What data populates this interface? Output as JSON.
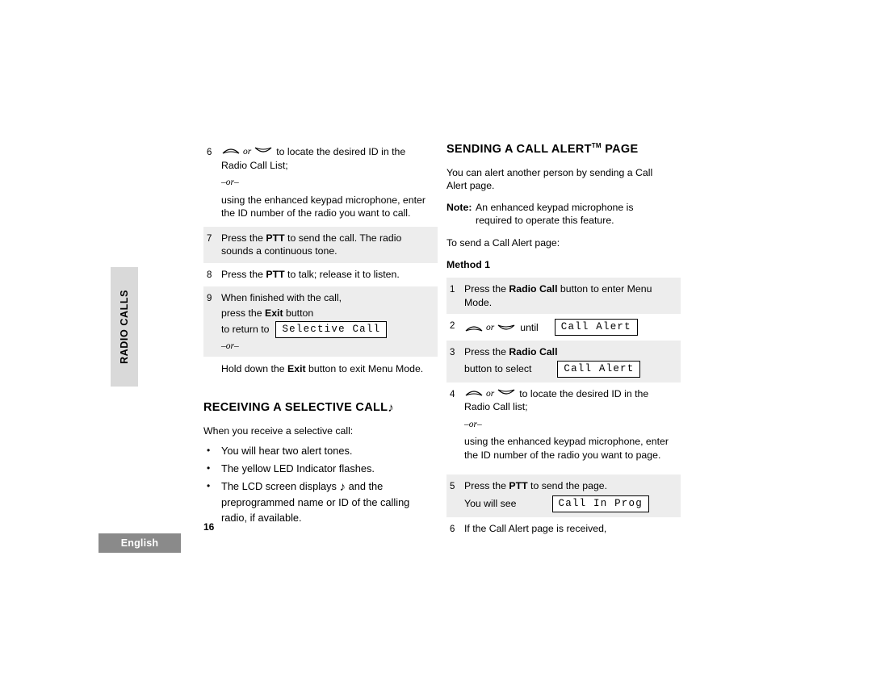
{
  "sidetab": {
    "label": "RADIO CALLS"
  },
  "footer": {
    "language": "English",
    "page_number": "16"
  },
  "left_column": {
    "steps": [
      {
        "num": "6",
        "line1_suffix": "to locate the desired ID in the",
        "line2": "Radio Call List;",
        "or": "–or–",
        "alt1": "using the enhanced keypad microphone, enter",
        "alt2": "the ID number of the radio you want to call."
      },
      {
        "num": "7",
        "t1": "Press the ",
        "b1": "PTT",
        "t2": " to send the call. The radio",
        "t3": "sounds a continuous tone."
      },
      {
        "num": "8",
        "t1": "Press the ",
        "b1": "PTT",
        "t2": " to talk; release it to listen."
      },
      {
        "num": "9",
        "t1": "When finished with the call,",
        "t2a": "press the ",
        "b2": "Exit",
        "t2b": " button",
        "t3": "to return to",
        "lcd": "Selective Call",
        "or": "–or–",
        "t4a": "Hold down the ",
        "b4": "Exit",
        "t4b": " button to exit Menu Mode."
      }
    ],
    "heading": "RECEIVING A SELECTIVE CALL",
    "intro": "When you receive a selective call:",
    "bullets": [
      {
        "text": "You will hear two alert tones."
      },
      {
        "text": "The yellow LED Indicator flashes."
      },
      {
        "pre": "The LCD screen displays",
        "post": "and the",
        "line2": "preprogrammed name or ID of the calling",
        "line3": "radio, if available."
      }
    ]
  },
  "right_column": {
    "heading": "SENDING A CALL ALERT",
    "heading_sup": "TM",
    "heading_tail": " PAGE",
    "intro1": "You can alert another person by sending a Call",
    "intro2": "Alert page.",
    "note_label": "Note:",
    "note1": "An enhanced keypad microphone is",
    "note2": "required to operate this feature.",
    "lead": "To send a Call Alert page:",
    "method_label": "Method",
    "method_num": "1",
    "steps": [
      {
        "num": "1",
        "t1": "Press the ",
        "b1": "Radio Call",
        "t2": " button to enter Menu Mode."
      },
      {
        "num": "2",
        "mid": "until",
        "lcd": "Call Alert"
      },
      {
        "num": "3",
        "t1": "Press the ",
        "b1": "Radio Call",
        "t2": "button to select",
        "lcd": "Call Alert"
      },
      {
        "num": "4",
        "line1_suffix": "to locate the desired ID in the",
        "line2": "Radio Call list;",
        "or": "–or–",
        "alt1": "using the enhanced keypad microphone, enter",
        "alt2": "the ID number of the radio you want to page."
      },
      {
        "num": "5",
        "t1": "Press the ",
        "b1": "PTT",
        "t2": " to send the page.",
        "t3": "You will see",
        "lcd": "Call In Prog"
      },
      {
        "num": "6",
        "t1": "If the Call Alert page is received,"
      }
    ]
  },
  "glyphs": {
    "or_italic": "or",
    "music_note": "♪"
  }
}
